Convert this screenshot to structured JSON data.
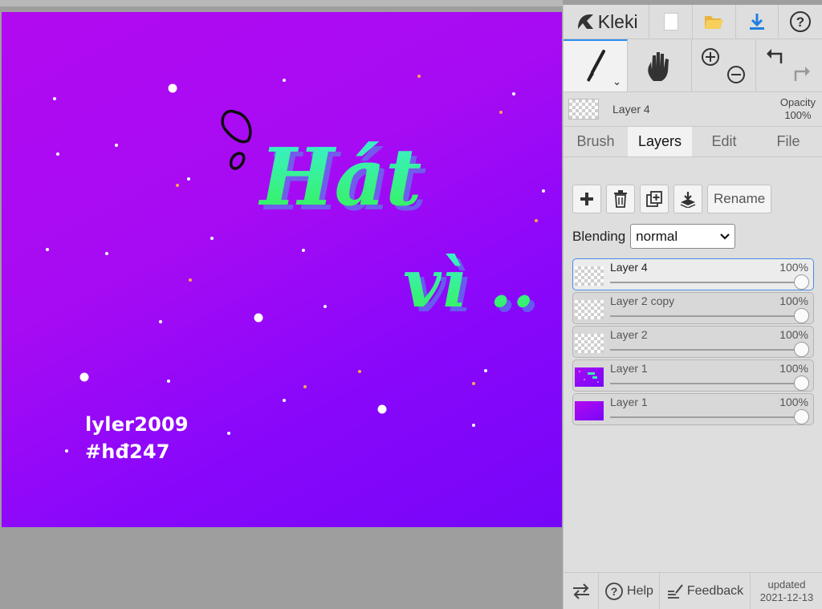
{
  "app": {
    "name": "Kleki"
  },
  "header": {
    "new_icon": "new-image-icon",
    "open_icon": "open-folder-icon",
    "save_icon": "download-icon",
    "help_icon": "help-icon"
  },
  "tools": {
    "brush_icon": "brush-icon",
    "hand_icon": "hand-icon",
    "zoom_in_icon": "zoom-in-icon",
    "zoom_out_icon": "zoom-out-icon",
    "undo_icon": "undo-icon",
    "redo_icon": "redo-icon"
  },
  "current_layer": {
    "name": "Layer 4",
    "opacity_label": "Opacity",
    "opacity_value": "100%"
  },
  "tabs": [
    {
      "label": "Brush"
    },
    {
      "label": "Layers"
    },
    {
      "label": "Edit"
    },
    {
      "label": "File"
    }
  ],
  "layer_tools": {
    "rename_label": "Rename"
  },
  "blending": {
    "label": "Blending",
    "value": "normal"
  },
  "layers": [
    {
      "name": "Layer 4",
      "opacity": "100%",
      "opacity_value": 1.0
    },
    {
      "name": "Layer 2 copy",
      "opacity": "100%",
      "opacity_value": 1.0
    },
    {
      "name": "Layer 2",
      "opacity": "100%",
      "opacity_value": 1.0
    },
    {
      "name": "Layer 1",
      "opacity": "100%",
      "opacity_value": 1.0
    },
    {
      "name": "Layer 1",
      "opacity": "100%",
      "opacity_value": 1.0
    }
  ],
  "footer": {
    "help_label": "Help",
    "feedback_label": "Feedback",
    "updated_label": "updated",
    "updated_date": "2021-12-13"
  },
  "canvas_art": {
    "title_line1": "Hát",
    "title_line2": "vì ..",
    "signature_line1": "lyler2009",
    "signature_line2": "#hđ247"
  },
  "colors": {
    "accent": "#2d8cf0",
    "canvas_purple": "#a60bf3",
    "canvas_violet": "#7606f8",
    "text_gradient_top": "#33f5c2",
    "text_gradient_bottom": "#33f55a"
  }
}
